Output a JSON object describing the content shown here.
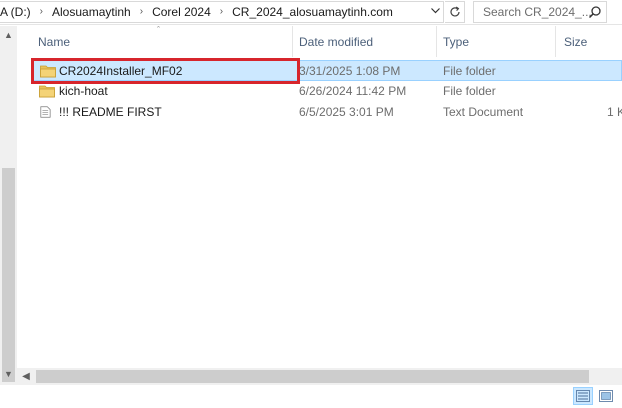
{
  "address_bar": {
    "crumbs": [
      "A (D:)",
      "Alosuamaytinh",
      "Corel 2024",
      "CR_2024_alosuamaytinh.com"
    ]
  },
  "search": {
    "placeholder": "Search CR_2024_..."
  },
  "columns": {
    "name": "Name",
    "date_modified": "Date modified",
    "type": "Type",
    "size": "Size"
  },
  "files": [
    {
      "name": "CR2024Installer_MF02",
      "date_modified": "3/31/2025 1:08 PM",
      "type": "File folder",
      "size": "",
      "icon": "folder-icon",
      "selected": true
    },
    {
      "name": "kich-hoat",
      "date_modified": "6/26/2024 11:42 PM",
      "type": "File folder",
      "size": "",
      "icon": "folder-icon",
      "selected": false
    },
    {
      "name": "!!! README FIRST",
      "date_modified": "6/5/2025 3:01 PM",
      "type": "Text Document",
      "size": "1 K",
      "icon": "text-document-icon",
      "selected": false
    }
  ],
  "colors": {
    "selection_bg": "#cce8ff",
    "selection_border": "#99d1ff",
    "highlight": "#d7252c",
    "header_text": "#4c607a",
    "folder": "#e8c25a"
  },
  "status_bar": {
    "views": [
      "details-view-icon",
      "large-icons-view-icon"
    ],
    "active_view": "details-view-icon"
  }
}
